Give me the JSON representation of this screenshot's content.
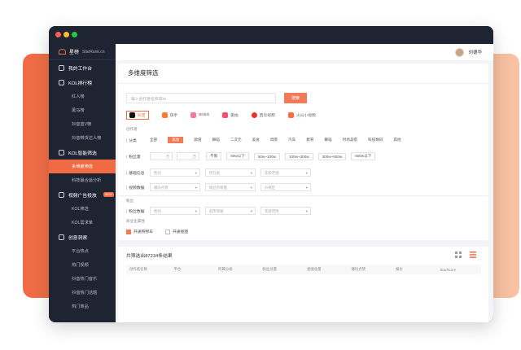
{
  "brand": {
    "name": "星榜",
    "sub": "StarRank.cn"
  },
  "user": {
    "name": "刘德华"
  },
  "sidebar": {
    "workspace": "我的工作台",
    "kol_rank": "KOL排行榜",
    "kol_rank_items": [
      "红人榜",
      "黑马榜",
      "抖音蓝V榜",
      "抖音带货达人榜"
    ],
    "kol_filter": "KOL智能筛选",
    "kol_filter_items": [
      "多维度筛选",
      "科技最合适分析"
    ],
    "video_ad": "视频广告投放",
    "video_ad_badge": "NEW",
    "video_ad_items": [
      "KOL筛选",
      "KOL需求单"
    ],
    "insight": "创意洞察",
    "insight_items": [
      "平台热点",
      "热门视频",
      "抖音热门音乐",
      "抖音热门话题",
      "热门商品"
    ]
  },
  "page": {
    "title": "多维度筛选"
  },
  "search": {
    "placeholder": "输入创作者名称或ID",
    "button": "搜索"
  },
  "platforms": [
    "抖音",
    "快手",
    "BiliBili",
    "美拍",
    "西瓜视频",
    "火山小视频"
  ],
  "filters": {
    "section_creator": "创作者",
    "category_label": "分类",
    "categories": [
      "全部",
      "美妆",
      "颜值",
      "舞蹈",
      "二次元",
      "美食",
      "母婴",
      "汽车",
      "教育",
      "舞蹈",
      "时尚美搭",
      "科技数码",
      "其他"
    ],
    "fans_label": "粉丝量",
    "fans_unit1": "万",
    "fans_unit2": "万",
    "fans_opts": [
      "不限",
      "50w以下",
      "50w~100w",
      "100w~300w",
      "300w~500w",
      "500w以下"
    ],
    "basic_label": "基础信息",
    "basic_boxes": [
      "性别",
      "所在地",
      "年龄范围"
    ],
    "video_label": "视频数据",
    "video_boxes": [
      "播均点赞",
      "粉丝月增量",
      "价格区"
    ],
    "section_fans": "粉丝",
    "fans_data_label": "粉丝数据",
    "fans_data_boxes": [
      "性别",
      "城市等级",
      "年龄范围"
    ],
    "section_business": "商业化属性",
    "checkbox1": "开通购物车",
    "checkbox2": "开通星图"
  },
  "results": {
    "text": "共筛选出87234条结果",
    "columns": [
      "创作者名称",
      "平台",
      "所属分类",
      "粉丝总量",
      "星图总量",
      "播均点赞",
      "报价",
      "StarScore"
    ]
  }
}
